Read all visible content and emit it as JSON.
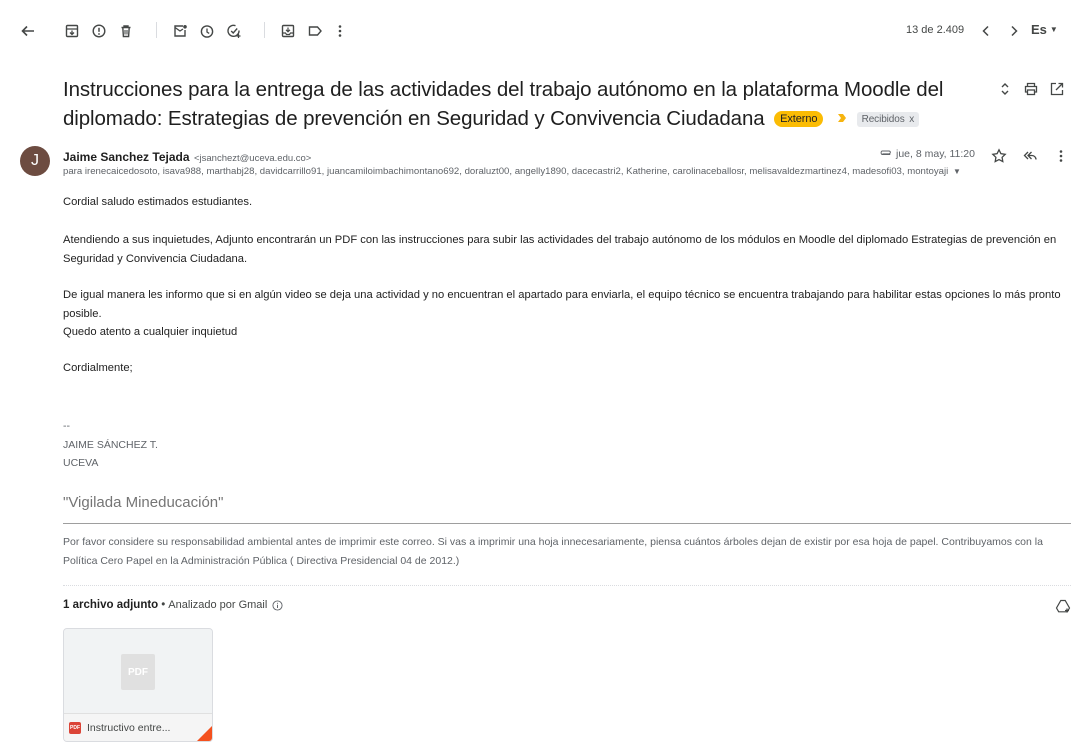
{
  "toolbar": {
    "icons": [
      "back-icon",
      "archive-icon",
      "report-spam-icon",
      "delete-icon",
      "mark-unread-icon",
      "snooze-icon",
      "add-task-icon",
      "move-to-icon",
      "label-icon",
      "more-vert-icon"
    ],
    "pagination": "13 de 2.409",
    "language": "Es"
  },
  "subject": {
    "text": "Instrucciones para la entrega de las actividades del trabajo autónomo en la plataforma Moodle del diplomado: Estrategias de prevención en Seguridad y Convivencia Ciudadana",
    "external_chip": "Externo",
    "label_chip": "Recibidos",
    "label_chip_close": "x",
    "external_color": "#fbbc04"
  },
  "sender": {
    "avatar_letter": "J",
    "avatar_color": "#6d4c41",
    "name": "Jaime Sanchez Tejada",
    "email": "<jsanchezt@uceva.edu.co>",
    "date": "jue, 8 may, 11:20",
    "recipients": "para irenecaicedosoto, isava988, marthabj28, davidcarrillo91, juancamiloimbachimontano692, doraluzt00, angelly1890, dacecastri2, Katherine, carolinaceballosr, melisavaldezmartinez4, madesofi03, montoyaji"
  },
  "body": {
    "greeting": "Cordial saludo estimados estudiantes.",
    "p1": "Atendiendo a sus inquietudes, Adjunto encontrarán un PDF con las instrucciones para subir las actividades del trabajo autónomo de los módulos en Moodle del diplomado Estrategias de prevención en Seguridad y Convivencia Ciudadana.",
    "p2": "De igual manera les informo que si en algún video se deja una actividad y no encuentran el apartado para enviarla, el equipo técnico se encuentra trabajando para habilitar estas opciones lo más pronto posible.",
    "p3": "Quedo atento a cualquier inquietud",
    "closing": "Cordialmente;",
    "sig_dash": "--",
    "sig_name": "JAIME SÁNCHEZ T.",
    "sig_org": "UCEVA",
    "vigilada": "\"Vigilada Mineducación\"",
    "footer": "Por favor considere su responsabilidad ambiental antes de imprimir este correo.  Si vas a imprimir una hoja innecesariamente, piensa cuántos árboles dejan de existir por esa hoja de papel.  Contribuyamos con la Política Cero Papel en la Administración Pública ( Directiva Presidencial 04 de 2012.)"
  },
  "attachments": {
    "count_label": "1 archivo adjunto",
    "scan_label": "Analizado por Gmail",
    "file_name": "Instructivo entre...",
    "thumb_text": "PDF",
    "badge_text": "PDF"
  }
}
